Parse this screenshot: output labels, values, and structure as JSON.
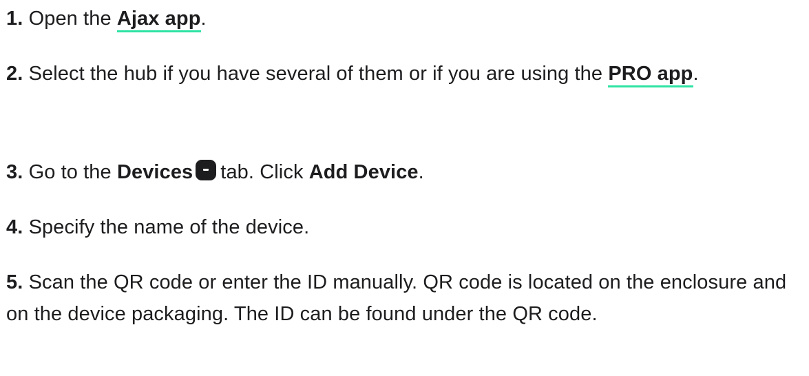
{
  "steps": [
    {
      "number": "1.",
      "text_before": "Open the",
      "link": "Ajax app",
      "text_after": "."
    },
    {
      "number": "2.",
      "text_before": "Select the hub if you have several of them or if you are using the",
      "link": "PRO app",
      "text_after": "."
    },
    {
      "number": "3.",
      "text_before": "Go to the",
      "bold_1": "Devices",
      "icon": "devices-icon",
      "text_middle": "tab. Click",
      "bold_2": "Add Device",
      "text_after": "."
    },
    {
      "number": "4.",
      "text": "Specify the name of the device."
    },
    {
      "number": "5.",
      "text": "Scan the QR code or enter the ID manually. QR code is located on the enclosure and on the device packaging. The ID can be found under the QR code."
    }
  ],
  "colors": {
    "text": "#1d1d1f",
    "link_underline": "#2ee3a3",
    "background": "#ffffff"
  }
}
